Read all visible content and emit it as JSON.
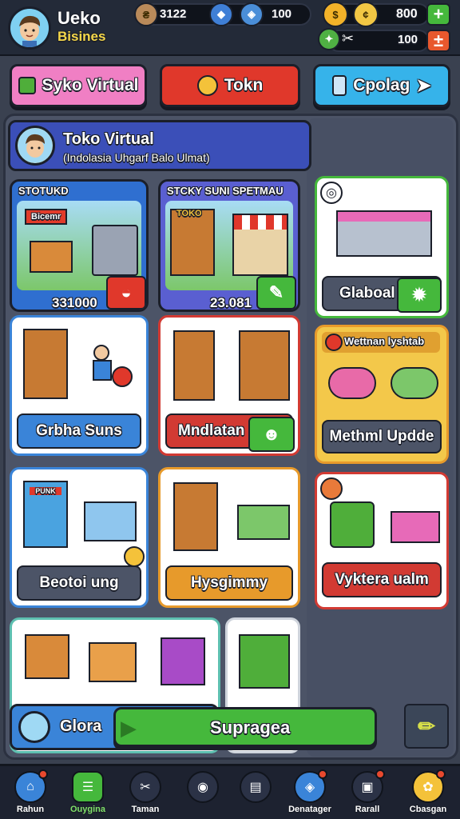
{
  "header": {
    "player_name_line1": "Ueko",
    "player_name_line2": "Bisines",
    "stat1": "3122",
    "stat2": "100",
    "coins": "800",
    "energy": "100",
    "plus": "+",
    "minus": "±"
  },
  "tabs": [
    {
      "label": "Syko Virtual",
      "color": "#f07fc4"
    },
    {
      "label": "Tokn",
      "color": "#e0382b"
    },
    {
      "label": "Cpolag",
      "color": "#36b3ea"
    }
  ],
  "profile": {
    "title": "Toko Virtual",
    "subtitle": "(Indolasia Uhgarf Balo Ulmat)"
  },
  "cards": [
    {
      "top": "STOTUKD",
      "sign": "Bicemr",
      "value": "331000"
    },
    {
      "top": "STCKY SUNI SPETMAU",
      "sign": "TOKO",
      "value": "23.081"
    },
    {
      "label": "Glaboal"
    },
    {
      "label": "Grbha Suns"
    },
    {
      "label": "Mndlatan"
    },
    {
      "top": "Wettnan lyshtab",
      "label": "Methml Updde"
    },
    {
      "sign": "PUNK",
      "label": "Beotoi ung"
    },
    {
      "label": "Hysgimmy"
    },
    {
      "label": "Vyktera ualm"
    }
  ],
  "bottom_bar": {
    "status_label": "Glora",
    "upgrade_label": "Supragea"
  },
  "nav": [
    {
      "label": "Rahun"
    },
    {
      "label": "Ouygina"
    },
    {
      "label": "Taman"
    },
    {
      "label": ""
    },
    {
      "label": ""
    },
    {
      "label": "Denatager"
    },
    {
      "label": "Rarall"
    },
    {
      "label": "Cbasgan"
    }
  ]
}
